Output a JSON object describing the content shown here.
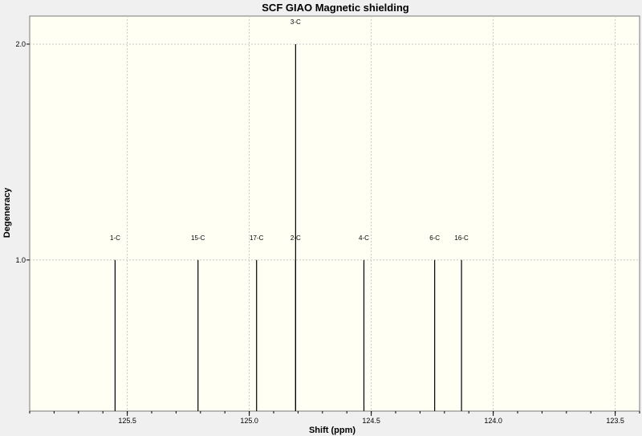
{
  "chart_data": {
    "type": "stick-spectrum",
    "title": "SCF GIAO Magnetic shielding",
    "xlabel": "Shift (ppm)",
    "ylabel": "Degeneracy",
    "xlim": [
      125.9,
      123.4
    ],
    "ylim": [
      0.3,
      2.13
    ],
    "x_reversed": true,
    "x_ticks": [
      {
        "value": 125.5,
        "label": "125.5"
      },
      {
        "value": 125.0,
        "label": "125.0"
      },
      {
        "value": 124.5,
        "label": "124.5"
      },
      {
        "value": 124.0,
        "label": "124.0"
      },
      {
        "value": 123.5,
        "label": "123.5"
      }
    ],
    "y_ticks": [
      {
        "value": 1.0,
        "label": "1.0"
      },
      {
        "value": 2.0,
        "label": "2.0"
      }
    ],
    "grid": true,
    "colors": {
      "plot_background": "#fffff4",
      "window_background": "#f0f0f0",
      "peak": "#000000",
      "grid": "#c8c8c8"
    },
    "peaks": [
      {
        "label": "1-C",
        "x": 125.55,
        "y": 1.0
      },
      {
        "label": "15-C",
        "x": 125.21,
        "y": 1.0
      },
      {
        "label": "17-C",
        "x": 124.97,
        "y": 1.0
      },
      {
        "label": "2-C",
        "x": 124.81,
        "y": 1.0
      },
      {
        "label": "3-C",
        "x": 124.81,
        "y": 2.0
      },
      {
        "label": "4-C",
        "x": 124.53,
        "y": 1.0
      },
      {
        "label": "6-C",
        "x": 124.24,
        "y": 1.0
      },
      {
        "label": "16-C",
        "x": 124.13,
        "y": 1.0
      }
    ]
  }
}
